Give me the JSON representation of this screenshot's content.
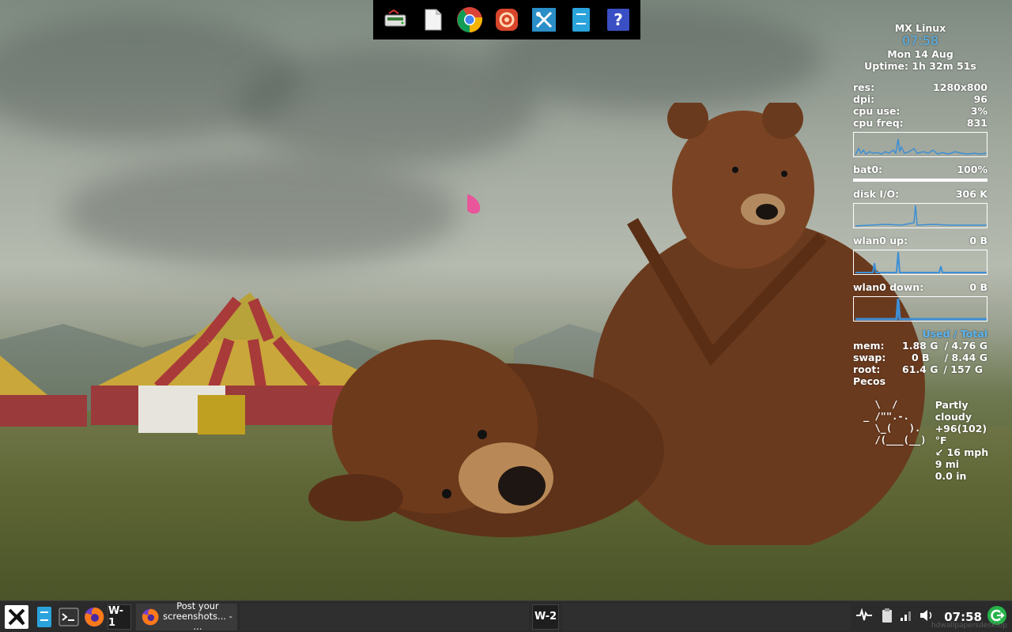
{
  "dock": {
    "items": [
      {
        "name": "disk-manager-icon"
      },
      {
        "name": "text-editor-icon"
      },
      {
        "name": "chrome-icon"
      },
      {
        "name": "software-installer-icon"
      },
      {
        "name": "mx-tools-icon"
      },
      {
        "name": "file-manager-icon"
      },
      {
        "name": "help-icon"
      }
    ]
  },
  "conky": {
    "distro": "MX Linux",
    "time": "07:58",
    "date": "Mon 14 Aug",
    "uptime": "Uptime: 1h 32m 51s",
    "system": [
      {
        "label": "res:",
        "value": "1280x800"
      },
      {
        "label": "dpi:",
        "value": "96"
      },
      {
        "label": "cpu use:",
        "value": "3%"
      },
      {
        "label": "cpu freq:",
        "value": "831"
      }
    ],
    "bat": {
      "label": "bat0:",
      "value": "100%",
      "level": 1.0
    },
    "disk": {
      "label": "disk I/O:",
      "value": "306 K"
    },
    "wlan_up": {
      "label": "wlan0 up:",
      "value": "0 B"
    },
    "wlan_down": {
      "label": "wlan0 down:",
      "value": "0 B"
    },
    "mem_header": "Used / Total",
    "memory": [
      {
        "label": "mem:",
        "used": "1.88 G",
        "total": "/ 4.76 G"
      },
      {
        "label": "swap:",
        "used": "0 B",
        "total": "/ 8.44 G"
      },
      {
        "label": "root:",
        "used": "61.4 G",
        "total": "/ 157 G"
      }
    ],
    "location": "Pecos",
    "weather": {
      "art": [
        "  \\  /      ",
        "_ /\"\".-.    ",
        "  \\_(   ).  ",
        "  /(___(__) ",
        "            "
      ],
      "lines": [
        "Partly cloudy",
        "+96(102) °F",
        "↙ 16 mph",
        "9 mi",
        "0.0 in"
      ]
    }
  },
  "taskbar": {
    "workspace1": "W-1",
    "workspace2": "W-2",
    "task_title": "Post your screenshots... - ...",
    "clock": "07:58",
    "watermark": "hdwallpapersdesktop"
  },
  "colors": {
    "accent": "#5ab4f0",
    "dock_bg": "#000000",
    "taskbar_bg": "#2b2b2b",
    "graph_line": "#3d8fd6"
  }
}
